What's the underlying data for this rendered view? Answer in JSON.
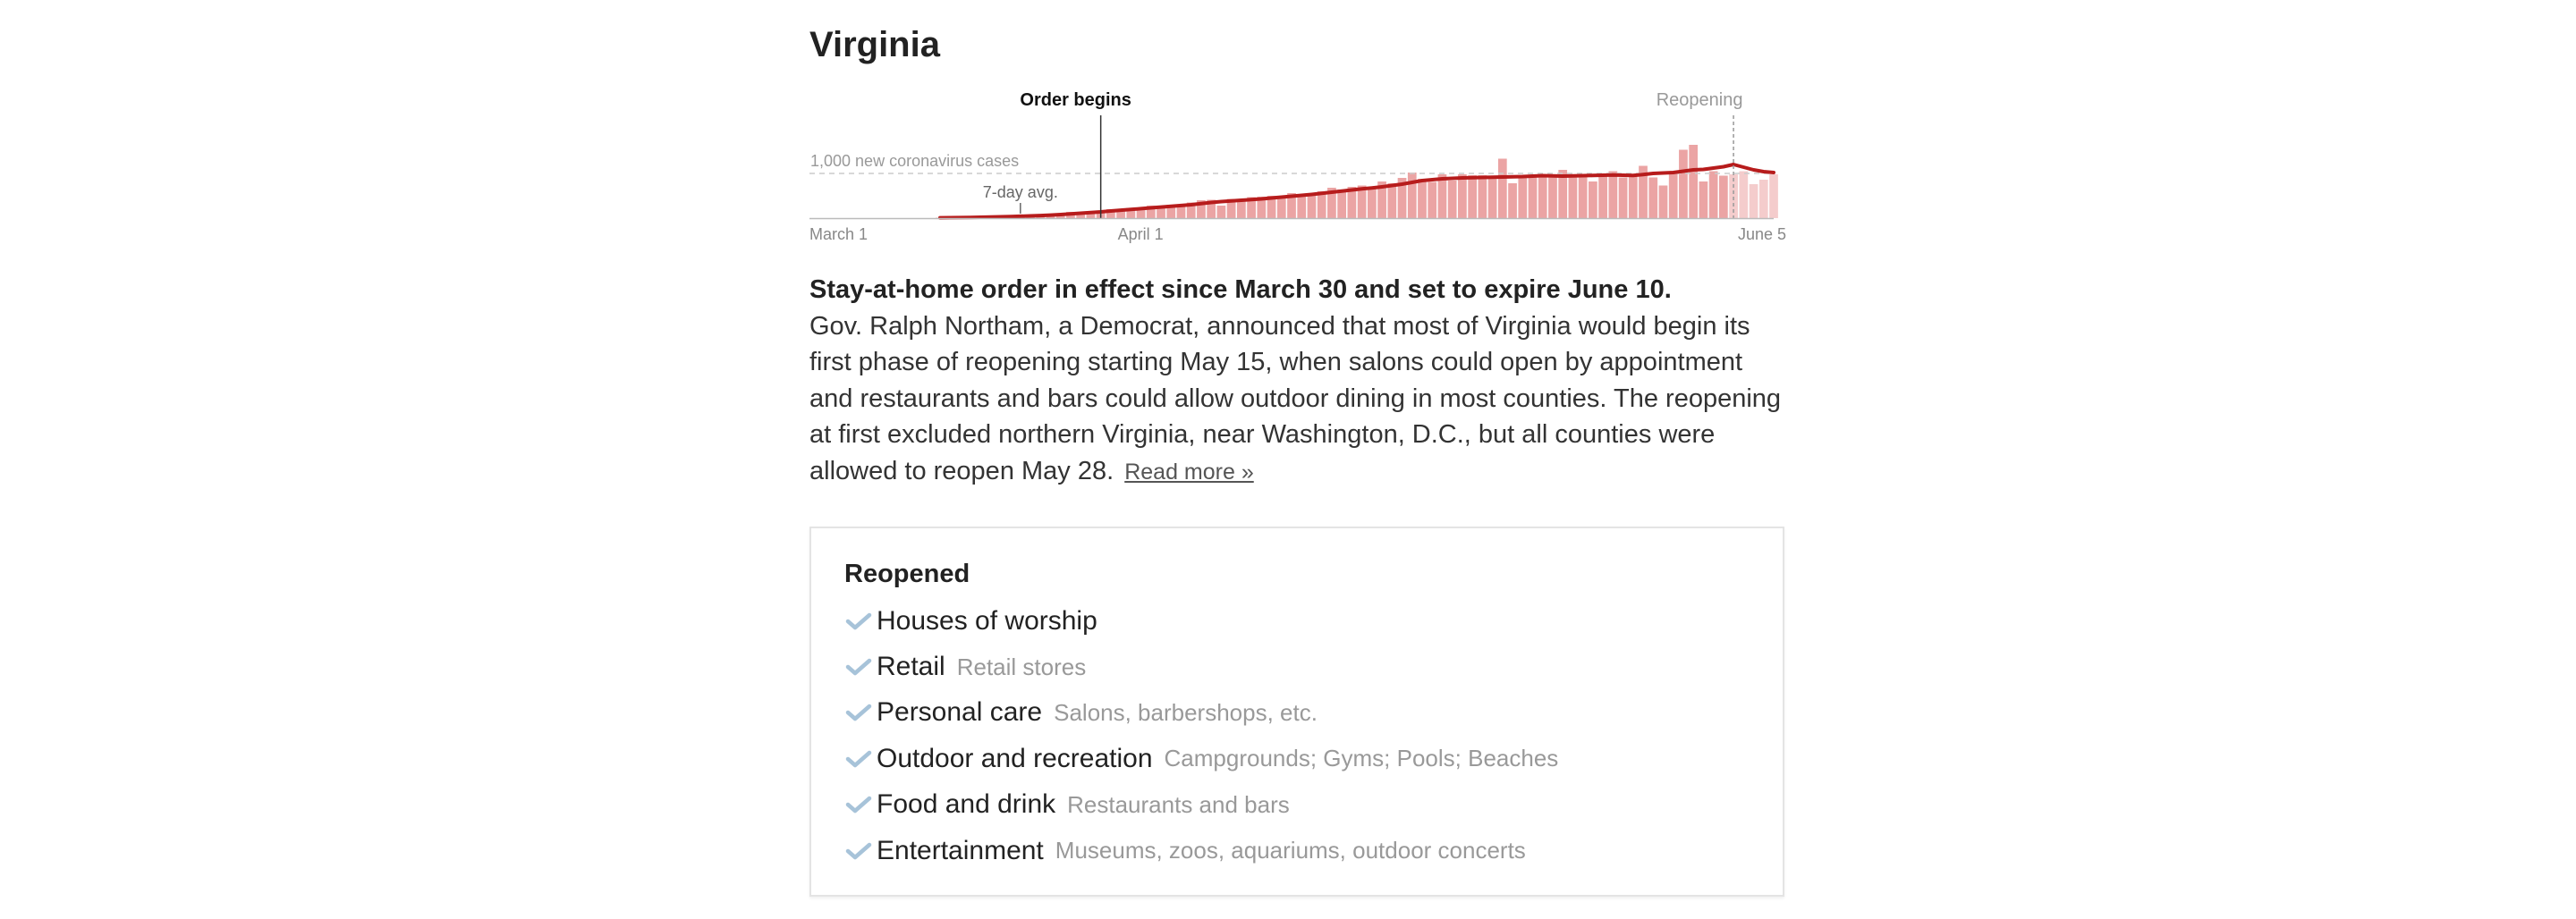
{
  "state": {
    "name": "Virginia"
  },
  "chart_data": {
    "type": "bar",
    "series_labels": {
      "daily": "",
      "avg": "7-day avg."
    },
    "title": "",
    "xlabel": "",
    "ylabel": "",
    "x_range": [
      "2020-03-01",
      "2020-06-05"
    ],
    "ylim": [
      0,
      1500
    ],
    "reference_line": {
      "value": 1000,
      "label": "1,000 new coronavirus cases"
    },
    "tick_labels": [
      "March 1",
      "April 1",
      "June 5"
    ],
    "events": [
      {
        "date": "2020-03-30",
        "label": "Order begins"
      },
      {
        "date": "2020-06-01",
        "label": "Reopening"
      }
    ],
    "avg_label": "7-day avg.",
    "x": [
      "2020-03-14",
      "2020-03-15",
      "2020-03-16",
      "2020-03-17",
      "2020-03-18",
      "2020-03-19",
      "2020-03-20",
      "2020-03-21",
      "2020-03-22",
      "2020-03-23",
      "2020-03-24",
      "2020-03-25",
      "2020-03-26",
      "2020-03-27",
      "2020-03-28",
      "2020-03-29",
      "2020-03-30",
      "2020-03-31",
      "2020-04-01",
      "2020-04-02",
      "2020-04-03",
      "2020-04-04",
      "2020-04-05",
      "2020-04-06",
      "2020-04-07",
      "2020-04-08",
      "2020-04-09",
      "2020-04-10",
      "2020-04-11",
      "2020-04-12",
      "2020-04-13",
      "2020-04-14",
      "2020-04-15",
      "2020-04-16",
      "2020-04-17",
      "2020-04-18",
      "2020-04-19",
      "2020-04-20",
      "2020-04-21",
      "2020-04-22",
      "2020-04-23",
      "2020-04-24",
      "2020-04-25",
      "2020-04-26",
      "2020-04-27",
      "2020-04-28",
      "2020-04-29",
      "2020-04-30",
      "2020-05-01",
      "2020-05-02",
      "2020-05-03",
      "2020-05-04",
      "2020-05-05",
      "2020-05-06",
      "2020-05-07",
      "2020-05-08",
      "2020-05-09",
      "2020-05-10",
      "2020-05-11",
      "2020-05-12",
      "2020-05-13",
      "2020-05-14",
      "2020-05-15",
      "2020-05-16",
      "2020-05-17",
      "2020-05-18",
      "2020-05-19",
      "2020-05-20",
      "2020-05-21",
      "2020-05-22",
      "2020-05-23",
      "2020-05-24",
      "2020-05-25",
      "2020-05-26",
      "2020-05-27",
      "2020-05-28",
      "2020-05-29",
      "2020-05-30",
      "2020-05-31",
      "2020-06-01",
      "2020-06-02",
      "2020-06-03",
      "2020-06-04",
      "2020-06-05"
    ],
    "values": [
      10,
      12,
      15,
      20,
      28,
      32,
      45,
      40,
      55,
      70,
      60,
      90,
      110,
      140,
      120,
      150,
      160,
      200,
      190,
      230,
      230,
      280,
      270,
      300,
      300,
      350,
      400,
      410,
      280,
      430,
      430,
      470,
      480,
      500,
      490,
      560,
      510,
      550,
      600,
      680,
      640,
      700,
      730,
      650,
      820,
      780,
      900,
      1020,
      880,
      810,
      980,
      840,
      980,
      960,
      960,
      880,
      1330,
      780,
      940,
      920,
      980,
      940,
      1080,
      970,
      920,
      820,
      940,
      1050,
      910,
      960,
      1170,
      910,
      730,
      1040,
      1530,
      1640,
      820,
      1050,
      950,
      980,
      1050,
      760,
      860,
      980
    ],
    "avg": [
      8,
      10,
      12,
      16,
      20,
      25,
      30,
      35,
      42,
      50,
      58,
      68,
      80,
      95,
      110,
      125,
      140,
      160,
      178,
      195,
      212,
      230,
      248,
      265,
      282,
      300,
      325,
      350,
      370,
      385,
      400,
      415,
      430,
      450,
      470,
      490,
      510,
      530,
      555,
      580,
      605,
      630,
      655,
      675,
      700,
      730,
      760,
      800,
      840,
      860,
      880,
      890,
      900,
      905,
      910,
      915,
      920,
      925,
      930,
      940,
      950,
      945,
      940,
      945,
      950,
      955,
      960,
      965,
      960,
      955,
      975,
      1000,
      1010,
      1020,
      1050,
      1080,
      1090,
      1120,
      1150,
      1200,
      1140,
      1080,
      1040,
      1020
    ]
  },
  "summary": {
    "headline": "Stay-at-home order in effect since March 30 and set to expire June 10.",
    "body": "Gov. Ralph Northam, a Democrat, announced that most of Virginia would begin its first phase of reopening starting May 15, when salons could open by appointment and restaurants and bars could allow outdoor dining in most counties. The reopening at first excluded northern Virginia, near Washington, D.C., but all counties were allowed to reopen May 28.",
    "read_more": "Read more »"
  },
  "status": {
    "heading": "Reopened",
    "check_color": "#a7c3d9",
    "items": [
      {
        "label": "Houses of worship",
        "detail": ""
      },
      {
        "label": "Retail",
        "detail": "Retail stores"
      },
      {
        "label": "Personal care",
        "detail": "Salons, barbershops, etc."
      },
      {
        "label": "Outdoor and recreation",
        "detail": "Campgrounds; Gyms; Pools; Beaches"
      },
      {
        "label": "Food and drink",
        "detail": "Restaurants and bars"
      },
      {
        "label": "Entertainment",
        "detail": "Museums, zoos, aquariums, outdoor concerts"
      }
    ]
  },
  "colors": {
    "bar": "#eba4a4",
    "bar_after_reopening": "#f4cccc",
    "avg_line": "#b71c1c",
    "event_line": "#333333",
    "reopening_line": "#999999"
  }
}
